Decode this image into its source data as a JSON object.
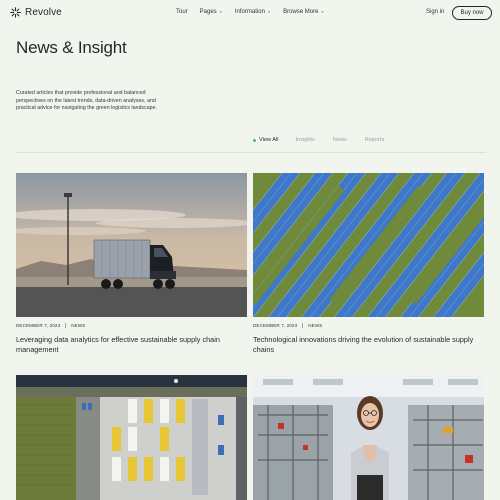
{
  "header": {
    "logo_text": "Revolve",
    "nav": [
      {
        "label": "Tour",
        "has_dropdown": false
      },
      {
        "label": "Pages",
        "has_dropdown": true
      },
      {
        "label": "Information",
        "has_dropdown": true
      },
      {
        "label": "Browse More",
        "has_dropdown": true
      }
    ],
    "signin_label": "Sign in",
    "buy_label": "Buy now"
  },
  "hero": {
    "title": "News & Insight",
    "intro": "Curated articles that provide professional and balanced perspectives on the latest trends, data-driven analyses, and practical advice for navigating the green logistics landscape."
  },
  "filters": {
    "tabs": [
      "View All",
      "Insights",
      "News",
      "Reports"
    ],
    "active": "View All",
    "active_dot_color": "#5cb85c"
  },
  "articles": [
    {
      "date": "DECEMBER 7, 2023",
      "category": "NEWS",
      "title": "Leveraging data analytics for effective sustainable supply chain management",
      "image": "truck-on-road-photo"
    },
    {
      "date": "DECEMBER 7, 2023",
      "category": "NEWS",
      "title": "Technological innovations driving the evolution of sustainable supply chains",
      "image": "solar-field-aerial-photo"
    },
    {
      "date": "",
      "category": "",
      "title": "",
      "image": "warehouse-aerial-photo"
    },
    {
      "date": "",
      "category": "",
      "title": "",
      "image": "woman-in-factory-photo"
    }
  ],
  "colors": {
    "background": "#f1f5ee",
    "text": "#1d2a22",
    "muted": "#9aa59d"
  }
}
